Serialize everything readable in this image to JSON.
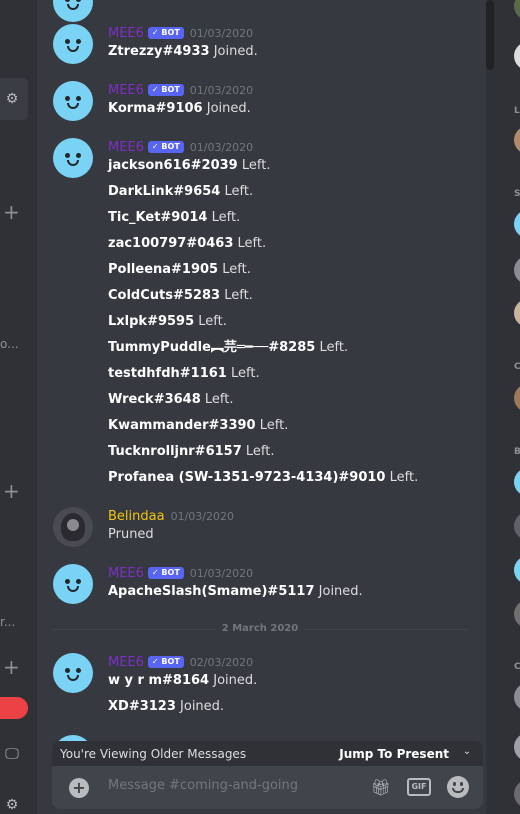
{
  "sidebar_left": {
    "truncated_texts": [
      "o...",
      "r..."
    ]
  },
  "messages": [
    {
      "author": "",
      "bot": false,
      "timestamp": "",
      "lines": [
        {
          "user": "",
          "action": ""
        }
      ],
      "partial": true
    },
    {
      "author": "MEE6",
      "bot_label": "BOT",
      "timestamp": "01/03/2020",
      "lines": [
        {
          "user": "Ztrezzy#4933",
          "action": "Joined."
        }
      ]
    },
    {
      "author": "MEE6",
      "bot_label": "BOT",
      "timestamp": "01/03/2020",
      "lines": [
        {
          "user": "Korma#9106",
          "action": "Joined."
        }
      ]
    },
    {
      "author": "MEE6",
      "bot_label": "BOT",
      "timestamp": "01/03/2020",
      "lines": [
        {
          "user": "jackson616#2039",
          "action": "Left."
        },
        {
          "user": "DarkLink#9654",
          "action": "Left."
        },
        {
          "user": "Tic_Ket#9014",
          "action": "Left."
        },
        {
          "user": "zac100797#0463",
          "action": "Left."
        },
        {
          "user": "Polleena#1905",
          "action": "Left."
        },
        {
          "user": "ColdCuts#5283",
          "action": "Left."
        },
        {
          "user": "Lxlpk#9595",
          "action": "Left."
        },
        {
          "user": "TummyPuddle︻芫═━──#8285",
          "action": "Left."
        },
        {
          "user": "testdhfdh#1161",
          "action": "Left."
        },
        {
          "user": "Wreck#3648",
          "action": "Left."
        },
        {
          "user": "Kwammander#3390",
          "action": "Left."
        },
        {
          "user": "Tucknrolljnr#6157",
          "action": "Left."
        },
        {
          "user": "Profanea (SW-1351-9723-4134)#9010",
          "action": "Left."
        }
      ]
    },
    {
      "author": "Belindaa",
      "timestamp": "01/03/2020",
      "lines": [
        {
          "text": "Pruned"
        }
      ]
    },
    {
      "author": "MEE6",
      "bot_label": "BOT",
      "timestamp": "01/03/2020",
      "lines": [
        {
          "user": "ApacheSlash(Smame)#5117",
          "action": "Joined."
        }
      ]
    },
    {
      "author": "MEE6",
      "bot_label": "BOT",
      "timestamp": "02/03/2020",
      "lines": [
        {
          "user": "w y r m#8164",
          "action": "Joined."
        },
        {
          "user": "XD#3123",
          "action": "Joined."
        }
      ]
    }
  ],
  "date_divider": "2 March 2020",
  "older_bar": {
    "text": "You're Viewing Older Messages",
    "jump": "Jump To Present"
  },
  "composer": {
    "placeholder": "Message #coming-and-going",
    "gif_label": "GIF"
  },
  "members_right": {
    "letters": [
      "L",
      "S",
      "C",
      "B",
      "C"
    ]
  },
  "colors": {
    "background": "#36393f",
    "bot_badge": "#5865f2",
    "mee6_name": "#7d2fc4",
    "belindaa_name": "#f1c40f"
  }
}
